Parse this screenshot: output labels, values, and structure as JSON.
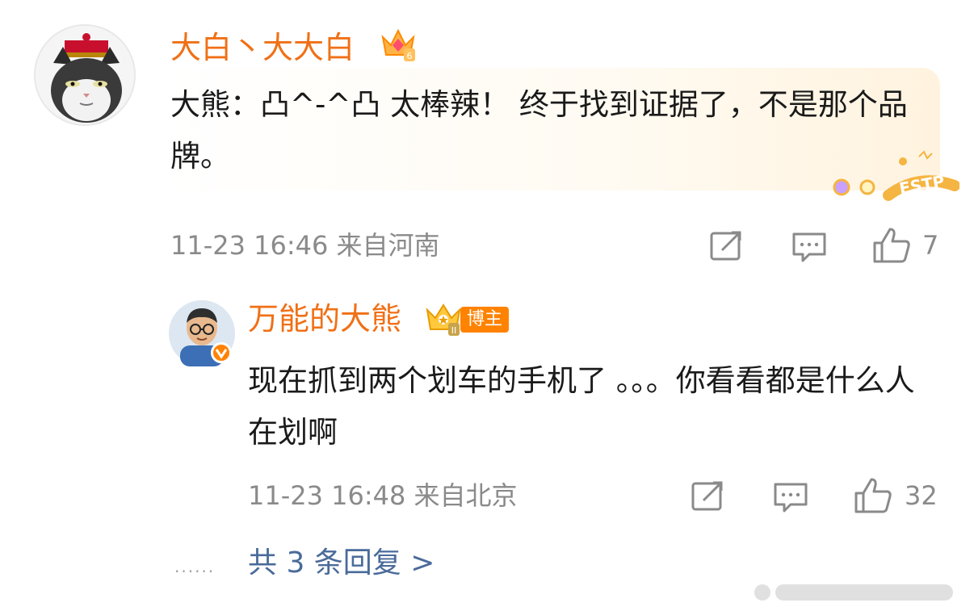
{
  "main_comment": {
    "username": "大白丶大大白",
    "level_badge": "6",
    "text": "大熊：凸^-^凸 太棒辣！ 终于找到证据了，不是那个品牌。",
    "mbti_tag": "ESTP",
    "timestamp": "11-23 16:46",
    "location": "来自河南",
    "like_count": "7"
  },
  "reply": {
    "username": "万能的大熊",
    "crown_level": "II",
    "role_tag": "博主",
    "text": "现在抓到两个划车的手机了 。。。你看看都是什么人在划啊",
    "timestamp": "11-23 16:48",
    "location": "来自北京",
    "like_count": "32"
  },
  "footer": {
    "dots": "......",
    "view_replies": "共 3 条回复 >"
  },
  "colors": {
    "username": "#f07016",
    "meta": "#8a8a8a",
    "link": "#4a6b9a",
    "accent": "#ff8200"
  },
  "icons": [
    "share-icon",
    "comment-icon",
    "like-icon"
  ]
}
